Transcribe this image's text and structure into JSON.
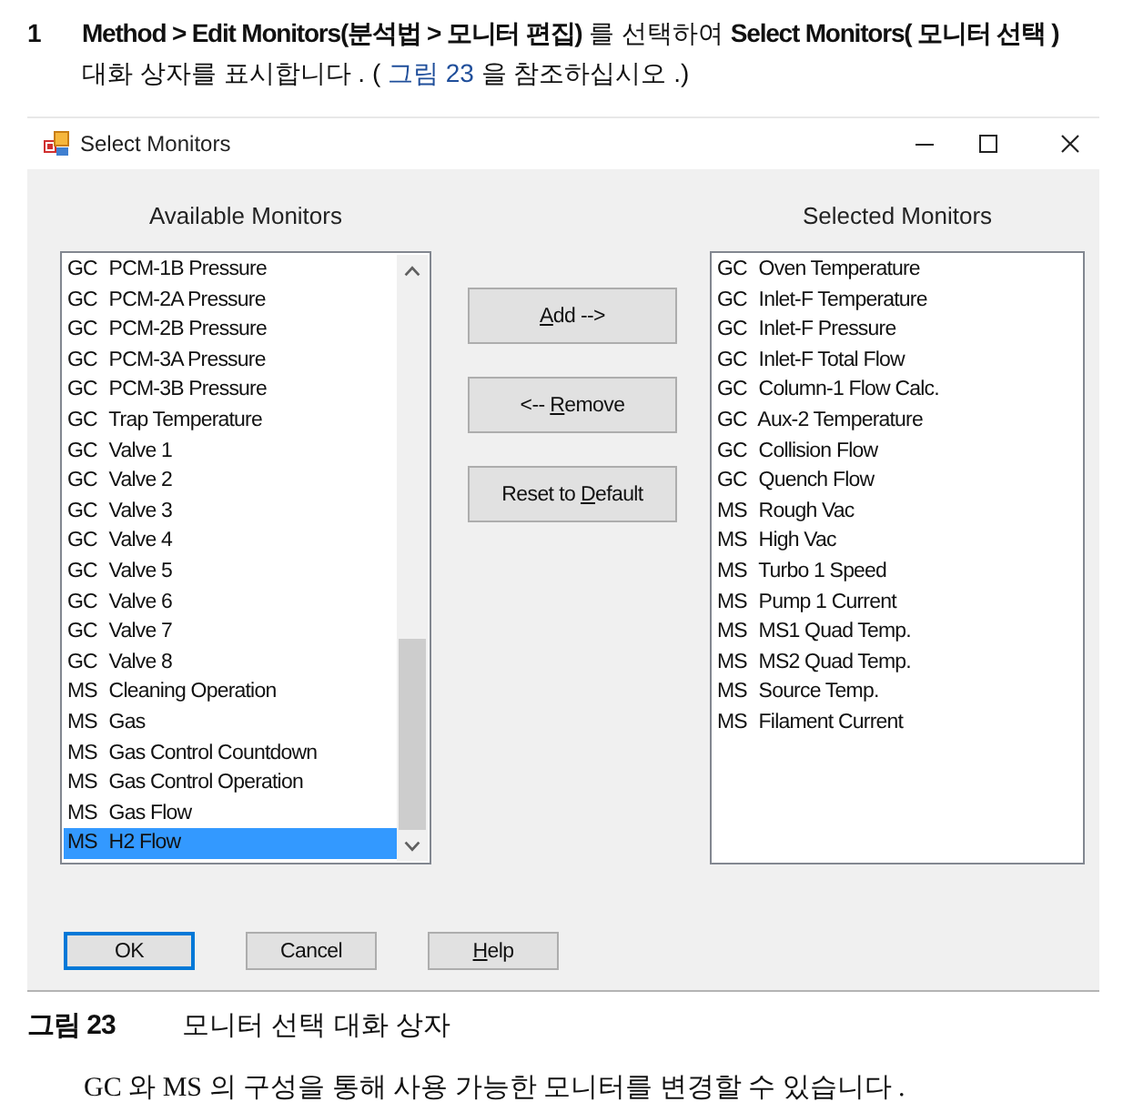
{
  "instruction": {
    "step": "1",
    "text": "**Method > Edit Monitors(분석법 > 모니터 편집)** 를 선택하여 **Select Monitors( 모니터 선택 )** 대화 상자를 표시합니다 . ( ",
    "link": "그림 23",
    "text_after_link": " 을 참조하십시오 .)"
  },
  "window": {
    "title": "Select Monitors"
  },
  "available_monitors": {
    "heading": "Available Monitors",
    "items": [
      {
        "group": "GC",
        "name": "PCM-1B Pressure",
        "selected": false
      },
      {
        "group": "GC",
        "name": "PCM-2A Pressure",
        "selected": false
      },
      {
        "group": "GC",
        "name": "PCM-2B Pressure",
        "selected": false
      },
      {
        "group": "GC",
        "name": "PCM-3A Pressure",
        "selected": false
      },
      {
        "group": "GC",
        "name": "PCM-3B Pressure",
        "selected": false
      },
      {
        "group": "GC",
        "name": "Trap Temperature",
        "selected": false
      },
      {
        "group": "GC",
        "name": "Valve 1",
        "selected": false
      },
      {
        "group": "GC",
        "name": "Valve 2",
        "selected": false
      },
      {
        "group": "GC",
        "name": "Valve 3",
        "selected": false
      },
      {
        "group": "GC",
        "name": "Valve 4",
        "selected": false
      },
      {
        "group": "GC",
        "name": "Valve 5",
        "selected": false
      },
      {
        "group": "GC",
        "name": "Valve 6",
        "selected": false
      },
      {
        "group": "GC",
        "name": "Valve 7",
        "selected": false
      },
      {
        "group": "GC",
        "name": "Valve 8",
        "selected": false
      },
      {
        "group": "MS",
        "name": "Cleaning Operation",
        "selected": false
      },
      {
        "group": "MS",
        "name": "Gas",
        "selected": false
      },
      {
        "group": "MS",
        "name": "Gas Control Countdown",
        "selected": false
      },
      {
        "group": "MS",
        "name": "Gas Control Operation",
        "selected": false
      },
      {
        "group": "MS",
        "name": "Gas Flow",
        "selected": false
      },
      {
        "group": "MS",
        "name": "H2 Flow",
        "selected": true
      }
    ]
  },
  "move_buttons": [
    {
      "key": "A",
      "rest": "dd -->"
    },
    {
      "lead": "<-- ",
      "key": "R",
      "rest": "emove"
    },
    {
      "lead": "Reset to ",
      "key": "D",
      "rest": "efault"
    }
  ],
  "selected_monitors": {
    "heading": "Selected Monitors",
    "items": [
      {
        "group": "GC",
        "name": "Oven Temperature",
        "selected": false
      },
      {
        "group": "GC",
        "name": "Inlet-F Temperature",
        "selected": false
      },
      {
        "group": "GC",
        "name": "Inlet-F Pressure",
        "selected": false
      },
      {
        "group": "GC",
        "name": "Inlet-F Total Flow",
        "selected": false
      },
      {
        "group": "GC",
        "name": "Column-1 Flow Calc.",
        "selected": false
      },
      {
        "group": "GC",
        "name": "Aux-2 Temperature",
        "selected": false
      },
      {
        "group": "GC",
        "name": "Collision Flow",
        "selected": false
      },
      {
        "group": "GC",
        "name": "Quench Flow",
        "selected": false
      },
      {
        "group": "MS",
        "name": "Rough Vac",
        "selected": false
      },
      {
        "group": "MS",
        "name": "High Vac",
        "selected": false
      },
      {
        "group": "MS",
        "name": "Turbo 1 Speed",
        "selected": false
      },
      {
        "group": "MS",
        "name": "Pump 1 Current",
        "selected": false
      },
      {
        "group": "MS",
        "name": "MS1 Quad Temp.",
        "selected": false
      },
      {
        "group": "MS",
        "name": "MS2 Quad Temp.",
        "selected": false
      },
      {
        "group": "MS",
        "name": "Source Temp.",
        "selected": false
      },
      {
        "group": "MS",
        "name": "Filament Current",
        "selected": false
      }
    ]
  },
  "dialog_buttons": [
    {
      "label": "OK",
      "default": true
    },
    {
      "label": "Cancel",
      "default": false
    },
    {
      "key": "H",
      "rest": "elp",
      "default": false
    }
  ],
  "caption": {
    "label": "그림 23",
    "text": "모니터 선택 대화 상자"
  },
  "note": "GC 와 MS 의 구성을 통해 사용 가능한 모니터를 변경할 수 있습니다 ."
}
